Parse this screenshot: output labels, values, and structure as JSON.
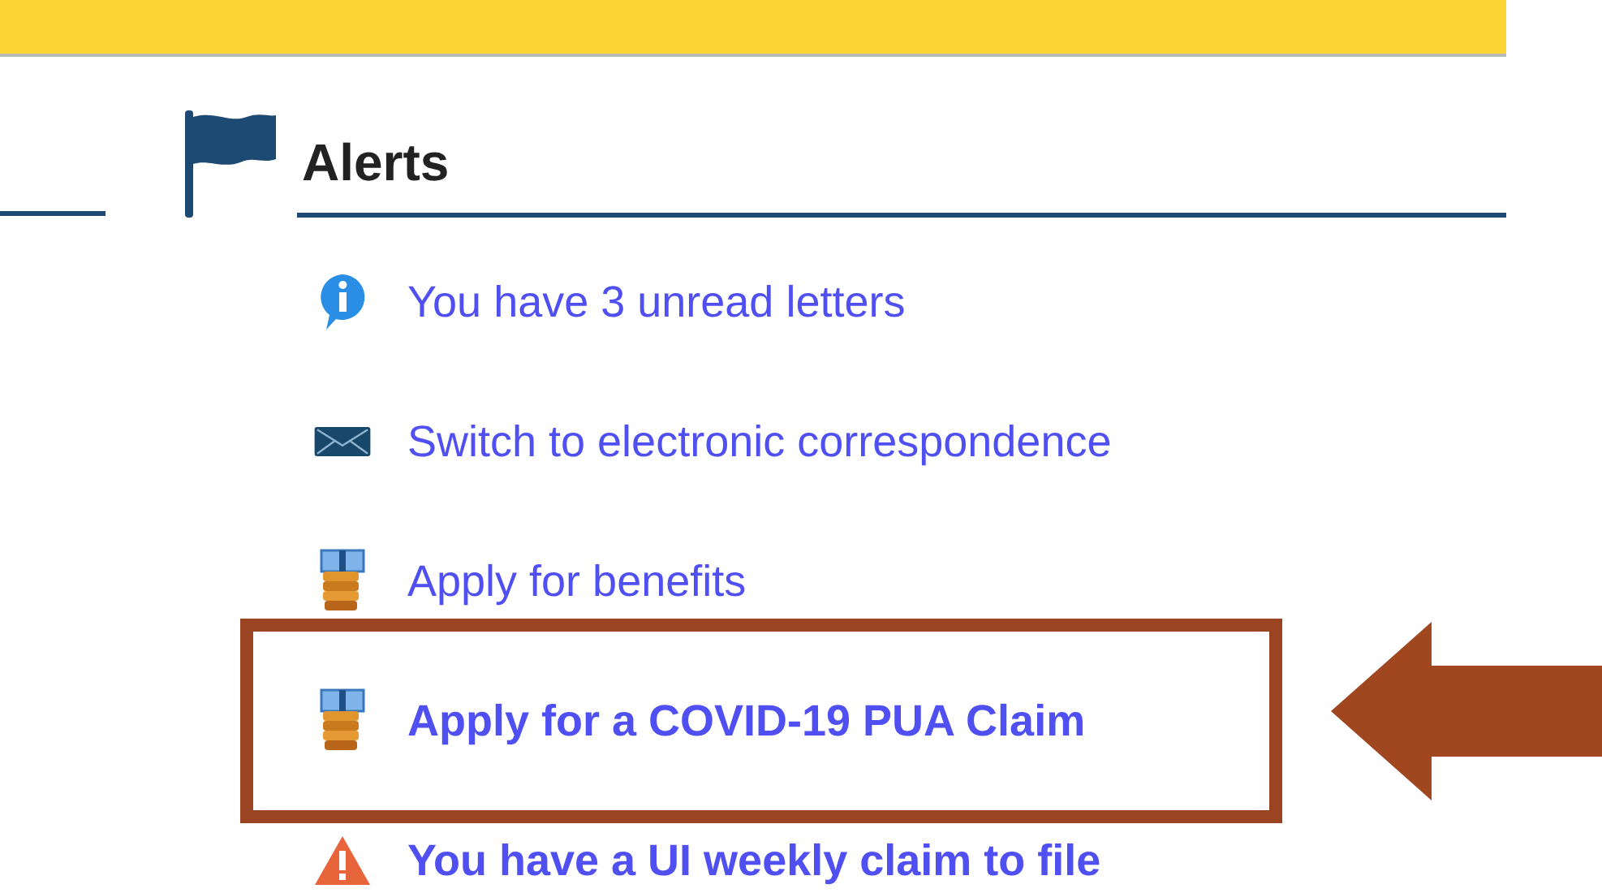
{
  "section": {
    "title": "Alerts"
  },
  "alerts": [
    {
      "kind": "info",
      "text": "You have 3 unread letters",
      "bold": false,
      "highlighted": false
    },
    {
      "kind": "mail",
      "text": "Switch to electronic correspondence",
      "bold": false,
      "highlighted": false
    },
    {
      "kind": "money",
      "text": "Apply for benefits",
      "bold": false,
      "highlighted": false
    },
    {
      "kind": "money",
      "text": "Apply for a COVID-19 PUA Claim",
      "bold": true,
      "highlighted": true
    },
    {
      "kind": "warning",
      "text": "You have a UI weekly claim to file",
      "bold": true,
      "highlighted": false
    }
  ]
}
